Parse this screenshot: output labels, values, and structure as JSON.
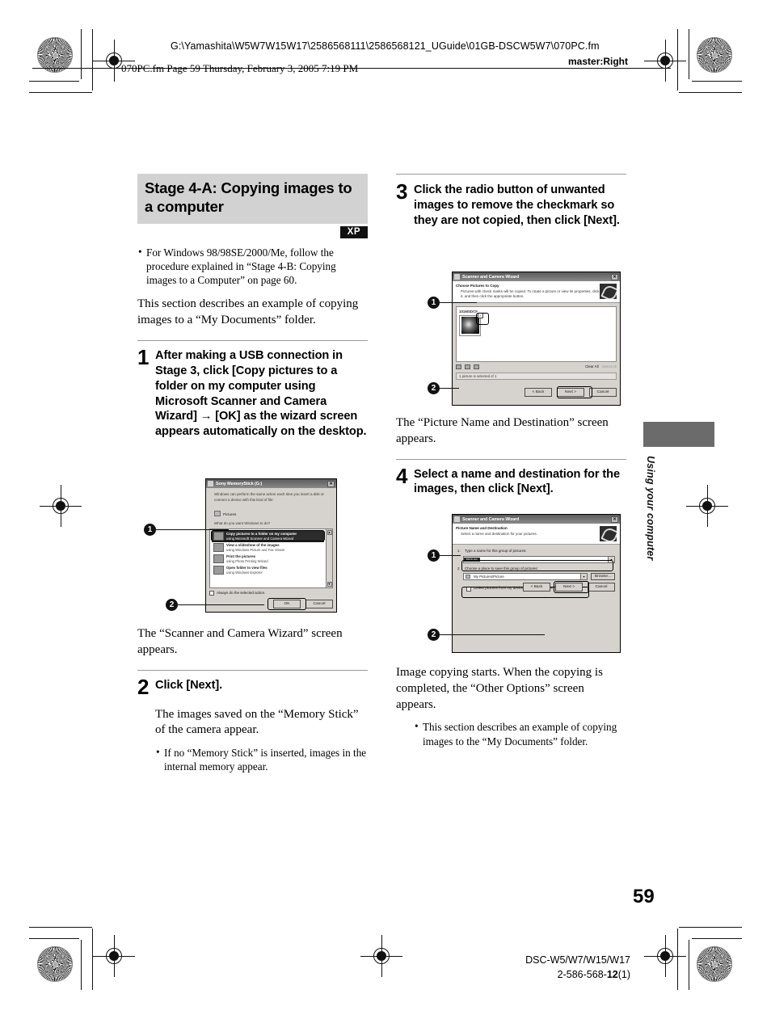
{
  "header": {
    "path": "G:\\Yamashita\\W5W7W15W17\\2586568111\\2586568121_UGuide\\01GB-DSCW5W7\\070PC.fm",
    "master": "master:Right",
    "file_line": "070PC.fm  Page 59  Thursday, February 3, 2005  7:19 PM"
  },
  "left_column": {
    "title": "Stage 4-A: Copying images to a computer",
    "xp_badge": "XP",
    "note_bullet": "For Windows 98/98SE/2000/Me, follow the procedure explained in “Stage 4-B: Copying images to a Computer” on page 60.",
    "intro": "This section describes an example of copying images to a “My Documents” folder.",
    "step1": {
      "number": "1",
      "text": "After making a USB connection in Stage 3, click [Copy pictures to a folder on my computer using Microsoft Scanner and Camera Wizard] → [OK] as the wizard screen appears automatically on the desktop.",
      "caption": "The “Scanner and Camera Wizard” screen appears.",
      "callouts": [
        "1",
        "2"
      ]
    },
    "step2": {
      "number": "2",
      "text": "Click [Next].",
      "caption": "The images saved on the “Memory Stick” of the camera appear.",
      "bullet": "If no “Memory Stick” is inserted, images in the internal memory appear."
    }
  },
  "right_column": {
    "step3": {
      "number": "3",
      "text": "Click the radio button of unwanted images to remove the checkmark so they are not copied, then click [Next].",
      "caption": "The “Picture Name and Destination” screen appears.",
      "callouts": [
        "1",
        "2"
      ]
    },
    "step4": {
      "number": "4",
      "text": "Select a name and destination for the images, then click [Next].",
      "caption": "Image copying starts. When the copying is completed, the “Other Options” screen appears.",
      "bullet": "This section describes an example of copying images to the “My Documents” folder.",
      "callouts": [
        "1",
        "2"
      ]
    }
  },
  "dialog_memorystick": {
    "title": "Sony MemoryStick (G:)",
    "close_glyph": "✕",
    "intro": "Windows can perform the same action each time you insert a disk or connect a device with this kind of file:",
    "kind_label": "Pictures",
    "question": "What do you want Windows to do?",
    "options": [
      {
        "title": "Copy pictures to a folder on my computer",
        "sub": "using Microsoft Scanner and Camera Wizard",
        "selected": true
      },
      {
        "title": "View a slideshow of the images",
        "sub": "using Windows Picture and Fax Viewer",
        "selected": false
      },
      {
        "title": "Print the pictures",
        "sub": "using Photo Printing Wizard",
        "selected": false
      },
      {
        "title": "Open folder to view files",
        "sub": "using Windows Explorer",
        "selected": false
      }
    ],
    "checkbox": "Always do the selected action.",
    "ok": "OK",
    "cancel": "Cancel",
    "scroll_up": "▲",
    "scroll_down": "▼"
  },
  "dialog_choose_pictures": {
    "title": "Scanner and Camera Wizard",
    "close_glyph": "✕",
    "heading": "Choose Pictures to Copy",
    "sub": "Pictures with check marks will be copied. To rotate a picture or view its properties, click it, and then click the appropriate button.",
    "group_label": "101MSDCF",
    "thumb_check": "✓",
    "clear_all": "Clear All",
    "select_all": "Select All",
    "status": "1 picture is selected of 1",
    "back": "< Back",
    "next": "Next >",
    "cancel": "Cancel"
  },
  "dialog_name_destination": {
    "title": "Scanner and Camera Wizard",
    "close_glyph": "✕",
    "heading": "Picture Name and Destination",
    "sub": "Select a name and destination for your pictures.",
    "field1_num": "1.",
    "field1_label": "Type a name for this group of pictures:",
    "field1_value": "Picture",
    "field2_num": "2.",
    "field2_label": "Choose a place to save this group of pictures:",
    "field2_value": "My Pictures\\Picture",
    "browse": "Browse...",
    "checkbox": "Delete pictures from my device after copying them",
    "combo_arrow": "▾",
    "back": "< Back",
    "next": "Next >",
    "cancel": "Cancel"
  },
  "side_tab": {
    "label": "Using your computer"
  },
  "footer": {
    "page_number": "59",
    "model": "DSC-W5/W7/W15/W17",
    "part_prefix": "2-586-568-",
    "part_bold": "12",
    "part_suffix": "(1)"
  }
}
